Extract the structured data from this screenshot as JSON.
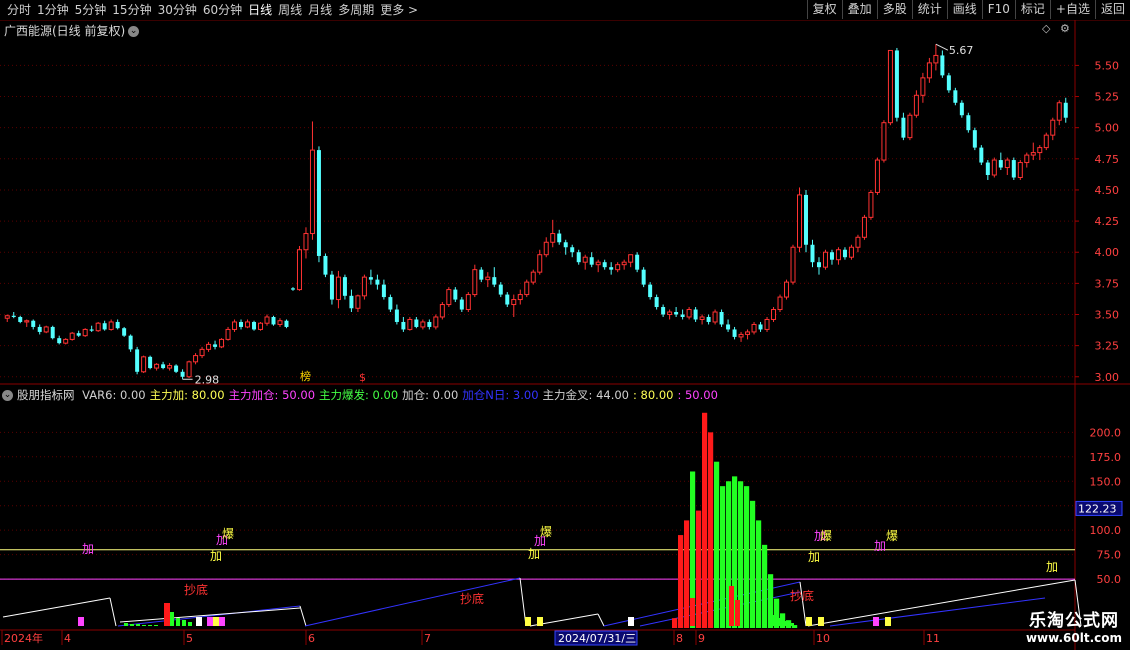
{
  "toolbar": {
    "periods": [
      "分时",
      "1分钟",
      "5分钟",
      "15分钟",
      "30分钟",
      "60分钟",
      "日线",
      "周线",
      "月线",
      "多周期",
      "更多"
    ],
    "active_period": "日线",
    "more_suffix": ">",
    "right_buttons": [
      "复权",
      "叠加",
      "多股",
      "统计",
      "画线",
      "F10",
      "标记",
      "+自选",
      "返回"
    ]
  },
  "main_panel": {
    "title": "广西能源(日线 前复权)",
    "price_high_label": "5.67",
    "price_low_label": "2.98",
    "event_marks": [
      "榜",
      "$"
    ]
  },
  "indicator_panel": {
    "name": "股朋指标网",
    "fields": [
      {
        "label": "VAR6:",
        "value": "0.00",
        "color": "#d0d0d0"
      },
      {
        "label": "主力加:",
        "value": "80.00",
        "color": "#ffff55"
      },
      {
        "label": "主力加仓:",
        "value": "50.00",
        "color": "#ff44ff"
      },
      {
        "label": "主力爆发:",
        "value": "0.00",
        "color": "#44ff44"
      },
      {
        "label": "加仓:",
        "value": "0.00",
        "color": "#d0d0d0"
      },
      {
        "label": "加仓N日:",
        "value": "3.00",
        "color": "#3333ff"
      },
      {
        "label": "主力金叉:",
        "value": "44.00",
        "color": "#d0d0d0"
      },
      {
        "label": ":",
        "value": "80.00",
        "color": "#ffff55"
      },
      {
        "label": ":",
        "value": "50.00",
        "color": "#ff44ff"
      }
    ],
    "current_value_tag": "122.23",
    "signal_texts": [
      "加",
      "爆",
      "抄底"
    ]
  },
  "x_axis": {
    "labels": [
      "2024年",
      "4",
      "5",
      "6",
      "7",
      "2024/07/31/三",
      "8",
      "9",
      "10",
      "11"
    ],
    "highlight": "2024/07/31/三"
  },
  "watermark": {
    "line1": "乐淘公式网",
    "line2": "www.60lt.com"
  },
  "colors": {
    "up": "#ff3232",
    "down": "#54ffff",
    "grid": "#5a0000",
    "axis_text": "#ff4040",
    "yellow_line": "#ffff80",
    "magenta_line": "#ff44ff",
    "blue_line": "#3333ff",
    "white_line": "#ffffff"
  },
  "chart_data": [
    {
      "type": "candlestick",
      "title": "广西能源(日线 前复权)",
      "y_ticks": [
        "5.50",
        "5.25",
        "5.00",
        "4.75",
        "4.50",
        "4.25",
        "4.00",
        "3.75",
        "3.50",
        "3.25",
        "3.00"
      ],
      "ylim": [
        2.95,
        5.72
      ],
      "annotations": [
        {
          "text": "5.67",
          "kind": "high"
        },
        {
          "text": "2.98",
          "kind": "low"
        }
      ],
      "ohlc": [
        [
          3.47,
          3.5,
          3.44,
          3.49
        ],
        [
          3.49,
          3.52,
          3.47,
          3.48
        ],
        [
          3.48,
          3.49,
          3.43,
          3.44
        ],
        [
          3.44,
          3.46,
          3.4,
          3.45
        ],
        [
          3.45,
          3.46,
          3.38,
          3.4
        ],
        [
          3.4,
          3.42,
          3.34,
          3.36
        ],
        [
          3.36,
          3.41,
          3.35,
          3.4
        ],
        [
          3.4,
          3.41,
          3.3,
          3.31
        ],
        [
          3.31,
          3.33,
          3.26,
          3.27
        ],
        [
          3.27,
          3.31,
          3.26,
          3.3
        ],
        [
          3.3,
          3.36,
          3.29,
          3.35
        ],
        [
          3.35,
          3.37,
          3.32,
          3.33
        ],
        [
          3.33,
          3.39,
          3.32,
          3.38
        ],
        [
          3.38,
          3.41,
          3.36,
          3.37
        ],
        [
          3.37,
          3.44,
          3.36,
          3.43
        ],
        [
          3.43,
          3.45,
          3.37,
          3.38
        ],
        [
          3.38,
          3.46,
          3.37,
          3.44
        ],
        [
          3.44,
          3.46,
          3.38,
          3.39
        ],
        [
          3.39,
          3.4,
          3.32,
          3.33
        ],
        [
          3.33,
          3.34,
          3.2,
          3.22
        ],
        [
          3.22,
          3.24,
          3.02,
          3.04
        ],
        [
          3.04,
          3.17,
          3.03,
          3.16
        ],
        [
          3.16,
          3.17,
          3.06,
          3.07
        ],
        [
          3.07,
          3.11,
          3.05,
          3.1
        ],
        [
          3.1,
          3.12,
          3.06,
          3.07
        ],
        [
          3.07,
          3.11,
          3.05,
          3.09
        ],
        [
          3.09,
          3.1,
          3.03,
          3.04
        ],
        [
          3.04,
          3.06,
          2.98,
          3.0
        ],
        [
          3.0,
          3.13,
          2.99,
          3.12
        ],
        [
          3.12,
          3.19,
          3.1,
          3.17
        ],
        [
          3.17,
          3.24,
          3.15,
          3.22
        ],
        [
          3.22,
          3.28,
          3.2,
          3.26
        ],
        [
          3.26,
          3.29,
          3.22,
          3.24
        ],
        [
          3.24,
          3.31,
          3.23,
          3.3
        ],
        [
          3.3,
          3.4,
          3.29,
          3.38
        ],
        [
          3.38,
          3.46,
          3.36,
          3.44
        ],
        [
          3.44,
          3.46,
          3.38,
          3.4
        ],
        [
          3.4,
          3.46,
          3.39,
          3.44
        ],
        [
          3.44,
          3.45,
          3.37,
          3.38
        ],
        [
          3.38,
          3.44,
          3.37,
          3.43
        ],
        [
          3.43,
          3.5,
          3.41,
          3.48
        ],
        [
          3.48,
          3.49,
          3.41,
          3.42
        ],
        [
          3.42,
          3.47,
          3.4,
          3.45
        ],
        [
          3.45,
          3.46,
          3.39,
          3.4
        ],
        [
          3.71,
          3.72,
          3.69,
          3.7
        ],
        [
          3.7,
          4.05,
          3.69,
          4.02
        ],
        [
          4.02,
          4.2,
          3.95,
          4.15
        ],
        [
          4.15,
          5.05,
          4.1,
          4.82
        ],
        [
          4.82,
          4.85,
          3.92,
          3.97
        ],
        [
          3.97,
          3.99,
          3.8,
          3.82
        ],
        [
          3.82,
          3.85,
          3.58,
          3.62
        ],
        [
          3.62,
          3.85,
          3.55,
          3.8
        ],
        [
          3.8,
          3.82,
          3.62,
          3.65
        ],
        [
          3.65,
          3.7,
          3.52,
          3.55
        ],
        [
          3.55,
          3.66,
          3.52,
          3.65
        ],
        [
          3.65,
          3.82,
          3.62,
          3.8
        ],
        [
          3.8,
          3.86,
          3.74,
          3.78
        ],
        [
          3.78,
          3.82,
          3.7,
          3.74
        ],
        [
          3.74,
          3.78,
          3.62,
          3.64
        ],
        [
          3.64,
          3.66,
          3.52,
          3.54
        ],
        [
          3.54,
          3.58,
          3.42,
          3.44
        ],
        [
          3.44,
          3.48,
          3.36,
          3.38
        ],
        [
          3.38,
          3.48,
          3.37,
          3.46
        ],
        [
          3.46,
          3.48,
          3.39,
          3.4
        ],
        [
          3.4,
          3.46,
          3.38,
          3.44
        ],
        [
          3.44,
          3.46,
          3.38,
          3.4
        ],
        [
          3.4,
          3.5,
          3.38,
          3.48
        ],
        [
          3.48,
          3.6,
          3.46,
          3.58
        ],
        [
          3.58,
          3.72,
          3.56,
          3.7
        ],
        [
          3.7,
          3.72,
          3.6,
          3.62
        ],
        [
          3.62,
          3.64,
          3.52,
          3.54
        ],
        [
          3.54,
          3.68,
          3.52,
          3.66
        ],
        [
          3.66,
          3.9,
          3.64,
          3.86
        ],
        [
          3.86,
          3.88,
          3.76,
          3.78
        ],
        [
          3.78,
          3.84,
          3.72,
          3.8
        ],
        [
          3.8,
          3.88,
          3.72,
          3.74
        ],
        [
          3.74,
          3.76,
          3.64,
          3.66
        ],
        [
          3.66,
          3.68,
          3.56,
          3.58
        ],
        [
          3.58,
          3.66,
          3.48,
          3.62
        ],
        [
          3.62,
          3.7,
          3.58,
          3.66
        ],
        [
          3.66,
          3.78,
          3.64,
          3.76
        ],
        [
          3.76,
          3.86,
          3.74,
          3.84
        ],
        [
          3.84,
          4.02,
          3.82,
          3.98
        ],
        [
          3.98,
          4.12,
          3.96,
          4.08
        ],
        [
          4.08,
          4.26,
          4.04,
          4.15
        ],
        [
          4.15,
          4.18,
          4.06,
          4.08
        ],
        [
          4.08,
          4.1,
          3.98,
          4.04
        ],
        [
          4.04,
          4.06,
          3.96,
          4.0
        ],
        [
          4.0,
          4.02,
          3.9,
          3.92
        ],
        [
          3.92,
          3.98,
          3.86,
          3.96
        ],
        [
          3.96,
          4.0,
          3.88,
          3.9
        ],
        [
          3.9,
          3.94,
          3.84,
          3.92
        ],
        [
          3.92,
          3.94,
          3.86,
          3.88
        ],
        [
          3.88,
          3.92,
          3.82,
          3.86
        ],
        [
          3.86,
          3.92,
          3.84,
          3.9
        ],
        [
          3.9,
          3.94,
          3.86,
          3.92
        ],
        [
          3.92,
          3.96,
          3.88,
          3.98
        ],
        [
          3.98,
          4.0,
          3.84,
          3.86
        ],
        [
          3.86,
          3.88,
          3.72,
          3.74
        ],
        [
          3.74,
          3.76,
          3.62,
          3.64
        ],
        [
          3.64,
          3.66,
          3.54,
          3.56
        ],
        [
          3.56,
          3.58,
          3.48,
          3.5
        ],
        [
          3.5,
          3.54,
          3.46,
          3.52
        ],
        [
          3.52,
          3.56,
          3.48,
          3.5
        ],
        [
          3.5,
          3.54,
          3.46,
          3.48
        ],
        [
          3.48,
          3.56,
          3.46,
          3.54
        ],
        [
          3.54,
          3.56,
          3.44,
          3.46
        ],
        [
          3.46,
          3.5,
          3.42,
          3.48
        ],
        [
          3.48,
          3.5,
          3.42,
          3.44
        ],
        [
          3.44,
          3.54,
          3.42,
          3.52
        ],
        [
          3.52,
          3.54,
          3.4,
          3.42
        ],
        [
          3.42,
          3.46,
          3.36,
          3.38
        ],
        [
          3.38,
          3.4,
          3.3,
          3.32
        ],
        [
          3.32,
          3.36,
          3.28,
          3.34
        ],
        [
          3.34,
          3.38,
          3.3,
          3.36
        ],
        [
          3.36,
          3.44,
          3.34,
          3.42
        ],
        [
          3.42,
          3.44,
          3.36,
          3.38
        ],
        [
          3.38,
          3.48,
          3.36,
          3.46
        ],
        [
          3.46,
          3.56,
          3.44,
          3.54
        ],
        [
          3.54,
          3.66,
          3.52,
          3.64
        ],
        [
          3.64,
          3.78,
          3.62,
          3.76
        ],
        [
          3.76,
          4.06,
          3.74,
          4.04
        ],
        [
          4.04,
          4.52,
          4.0,
          4.46
        ],
        [
          4.46,
          4.5,
          4.0,
          4.06
        ],
        [
          4.06,
          4.1,
          3.88,
          3.92
        ],
        [
          3.92,
          3.96,
          3.82,
          3.88
        ],
        [
          3.88,
          4.02,
          3.86,
          4.0
        ],
        [
          4.0,
          4.02,
          3.9,
          3.94
        ],
        [
          3.94,
          4.04,
          3.9,
          4.02
        ],
        [
          4.02,
          4.04,
          3.94,
          3.96
        ],
        [
          3.96,
          4.06,
          3.94,
          4.04
        ],
        [
          4.04,
          4.14,
          4.0,
          4.12
        ],
        [
          4.12,
          4.3,
          4.1,
          4.28
        ],
        [
          4.28,
          4.5,
          4.26,
          4.48
        ],
        [
          4.48,
          4.76,
          4.46,
          4.74
        ],
        [
          4.74,
          5.06,
          4.72,
          5.04
        ],
        [
          5.04,
          5.62,
          5.02,
          5.62
        ],
        [
          5.62,
          5.64,
          5.05,
          5.08
        ],
        [
          5.08,
          5.12,
          4.9,
          4.92
        ],
        [
          4.92,
          5.12,
          4.9,
          5.1
        ],
        [
          5.1,
          5.3,
          5.08,
          5.26
        ],
        [
          5.26,
          5.44,
          5.2,
          5.4
        ],
        [
          5.4,
          5.56,
          5.36,
          5.52
        ],
        [
          5.52,
          5.67,
          5.46,
          5.58
        ],
        [
          5.58,
          5.62,
          5.4,
          5.42
        ],
        [
          5.42,
          5.44,
          5.28,
          5.3
        ],
        [
          5.3,
          5.32,
          5.18,
          5.2
        ],
        [
          5.2,
          5.22,
          5.08,
          5.1
        ],
        [
          5.1,
          5.12,
          4.96,
          4.98
        ],
        [
          4.98,
          5.0,
          4.82,
          4.84
        ],
        [
          4.84,
          4.86,
          4.7,
          4.72
        ],
        [
          4.72,
          4.74,
          4.58,
          4.62
        ],
        [
          4.62,
          4.76,
          4.6,
          4.74
        ],
        [
          4.74,
          4.8,
          4.66,
          4.68
        ],
        [
          4.68,
          4.76,
          4.62,
          4.74
        ],
        [
          4.74,
          4.76,
          4.58,
          4.6
        ],
        [
          4.6,
          4.74,
          4.58,
          4.72
        ],
        [
          4.72,
          4.8,
          4.68,
          4.78
        ],
        [
          4.78,
          4.88,
          4.74,
          4.8
        ],
        [
          4.8,
          4.86,
          4.74,
          4.84
        ],
        [
          4.84,
          4.96,
          4.82,
          4.94
        ],
        [
          4.94,
          5.08,
          4.9,
          5.06
        ],
        [
          5.06,
          5.22,
          5.02,
          5.2
        ],
        [
          5.2,
          5.24,
          5.04,
          5.08
        ]
      ]
    },
    {
      "type": "bar",
      "title": "股朋指标网",
      "y_ticks": [
        "200.0",
        "175.0",
        "150.0",
        "125.0",
        "100.0",
        "75.0",
        "50.0"
      ],
      "ylim": [
        0,
        230
      ],
      "reference_lines": [
        {
          "name": "主力加",
          "value": 80
        },
        {
          "name": "主力加仓",
          "value": 50
        }
      ],
      "series": [
        {
          "name": "主力爆发",
          "values": [
            10,
            95,
            110,
            160,
            120,
            220,
            200,
            170,
            145,
            150,
            155,
            150,
            145,
            130,
            110,
            85,
            55,
            30,
            15,
            8,
            3
          ]
        }
      ]
    }
  ]
}
